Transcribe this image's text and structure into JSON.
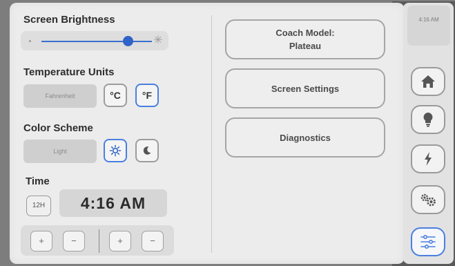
{
  "status": {
    "time": "4:16 AM"
  },
  "brightness": {
    "title": "Screen Brightness",
    "level": 0.78
  },
  "temperature": {
    "title": "Temperature Units",
    "current_label": "Fahrenheit",
    "celsius_label": "°C",
    "fahrenheit_label": "°F",
    "selected": "F"
  },
  "color_scheme": {
    "title": "Color Scheme",
    "current_label": "Light",
    "selected": "light"
  },
  "time_settings": {
    "title": "Time",
    "format_label": "12H",
    "display": "4:16 AM",
    "hour_plus": "+",
    "hour_minus": "−",
    "minute_plus": "+",
    "minute_minus": "−"
  },
  "menu": {
    "coach_model_line1": "Coach Model:",
    "coach_model_line2": "Plateau",
    "screen_settings": "Screen Settings",
    "diagnostics": "Diagnostics"
  },
  "nav": {
    "items": [
      {
        "icon": "home-icon",
        "active": false
      },
      {
        "icon": "lightbulb-icon",
        "active": false
      },
      {
        "icon": "lightning-icon",
        "active": false
      },
      {
        "icon": "gears-icon",
        "active": false
      },
      {
        "icon": "sliders-icon",
        "active": true
      }
    ]
  },
  "colors": {
    "accent": "#3a6fcf",
    "active_border": "#4a7fe0"
  }
}
